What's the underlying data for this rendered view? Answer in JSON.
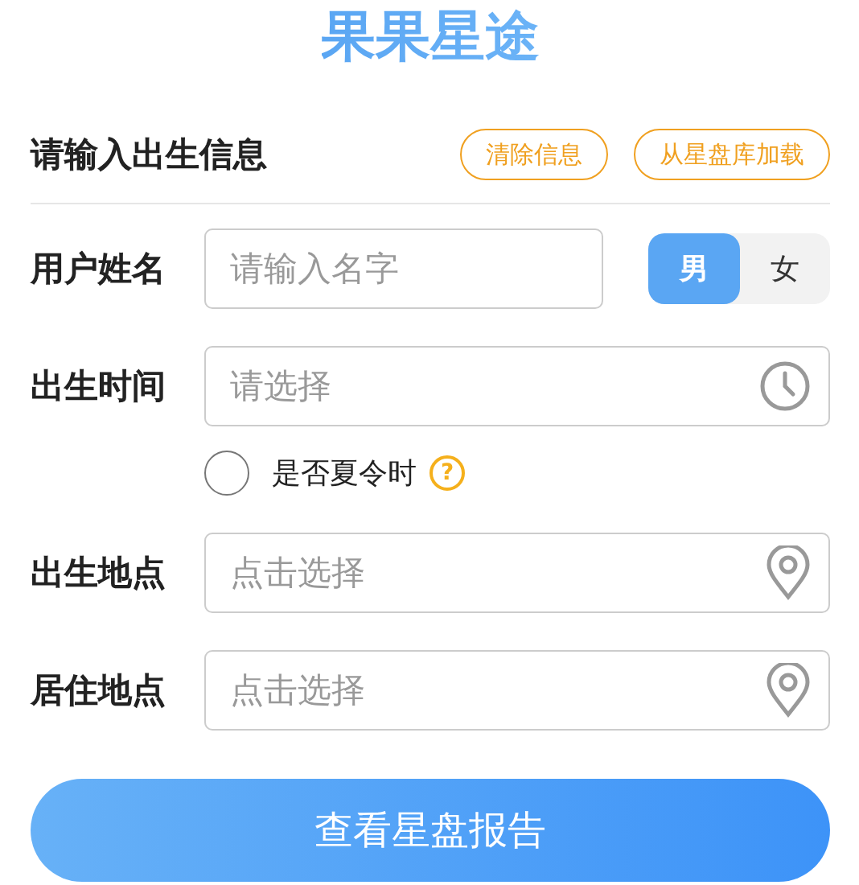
{
  "title": "果果星途",
  "section": {
    "heading": "请输入出生信息",
    "actions": [
      "清除信息",
      "从星盘库加载"
    ]
  },
  "fields": [
    {
      "kind": "name",
      "label": "用户姓名",
      "placeholder": "请输入名字",
      "genders": [
        {
          "label": "男",
          "selected": true
        },
        {
          "label": "女",
          "selected": false
        }
      ]
    },
    {
      "kind": "time",
      "label": "出生时间",
      "placeholder": "请选择",
      "dst": {
        "label": "是否夏令时",
        "checked": false,
        "help": "?"
      }
    },
    {
      "kind": "place",
      "label": "出生地点",
      "placeholder": "点击选择"
    },
    {
      "kind": "place",
      "label": "居住地点",
      "placeholder": "点击选择"
    }
  ],
  "submit": "查看星盘报告"
}
